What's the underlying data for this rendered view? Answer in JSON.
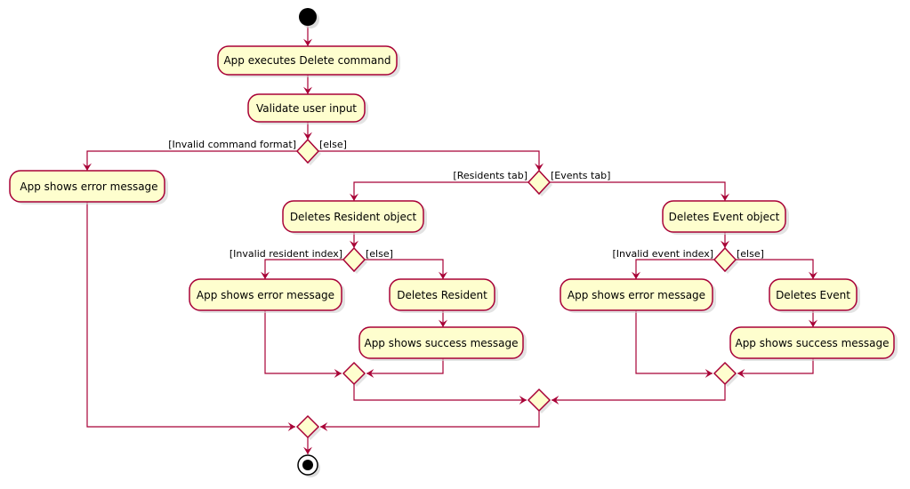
{
  "diagram": {
    "type": "uml-activity",
    "colors": {
      "line": "#A80036",
      "activity_fill": "#FEFECE",
      "node": "#000000"
    },
    "activities": {
      "execute": "App executes Delete command",
      "validate": "Validate user input",
      "error_main": "App shows error message",
      "delete_resident_obj": "Deletes Resident object",
      "delete_event_obj": "Deletes Event object",
      "error_resident": "App shows error message",
      "delete_resident": "Deletes Resident",
      "success_resident": "App shows success message",
      "error_event": "App shows error message",
      "delete_event": "Deletes Event",
      "success_event": "App shows success message"
    },
    "guards": {
      "invalid_format": "[Invalid command format]",
      "else_main": "[else]",
      "residents_tab": "[Residents tab]",
      "events_tab": "[Events tab]",
      "invalid_resident": "[Invalid resident index]",
      "else_resident": "[else]",
      "invalid_event": "[Invalid event index]",
      "else_event": "[else]"
    },
    "nodes": {
      "start": "start-node",
      "end": "end-node"
    }
  }
}
